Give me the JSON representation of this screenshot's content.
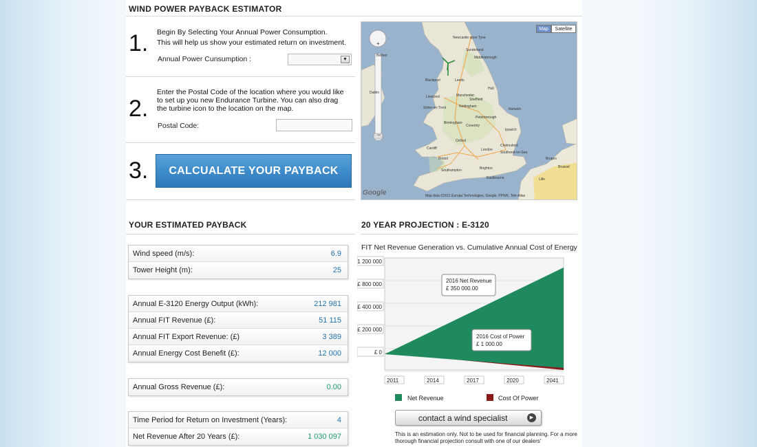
{
  "app": {
    "title": "WIND POWER PAYBACK ESTIMATOR"
  },
  "step1": {
    "number": "1.",
    "line1": "Begin By Selecting Your Annual Power Consumption.",
    "line2": "This will help us show your estimated return on investment.",
    "field_label": "Annual Power Cunsumption :",
    "select_value": ""
  },
  "step2": {
    "number": "2.",
    "line1": "Enter the Postal Code of the location where you would like",
    "line2": "to set up you new Endurance Turbine. You can also drag",
    "line3": "the turbine icon to the location on the map.",
    "field_label": "Postal Code:",
    "input_value": ""
  },
  "step3": {
    "number": "3.",
    "button_label": "CALCUALATE YOUR PAYBACK"
  },
  "map": {
    "map_button": "Map",
    "satellite_button": "Satellite",
    "attribution": "Map data ©2011 Europa Technologies, Google, PPWK, Tele Atlas",
    "google_logo": "Google",
    "cities": [
      "Glasgow",
      "Edinburgh",
      "Newcastle upon Tyne",
      "Sunderland",
      "Middlesbrough",
      "Belfast",
      "Blackpool",
      "Leeds",
      "Hull",
      "Manchester",
      "Liverpool",
      "Sheffield",
      "Stoke-on-Trent",
      "Nottingham",
      "Norwich",
      "Birmingham",
      "Coventry",
      "Peterborough",
      "Ipswich",
      "Oxford",
      "Chelmsford",
      "London",
      "Southend-on-Sea",
      "Cardiff",
      "Bristol",
      "Southampton",
      "Brighton",
      "Eastbourne",
      "Bruges",
      "Brussel",
      "Lille",
      "Dublin",
      "Swansea",
      "Telford",
      "Luton",
      "Reading"
    ]
  },
  "payback": {
    "heading": "YOUR ESTIMATED PAYBACK",
    "group1": [
      {
        "label": "Wind speed (m/s):",
        "value": "6.9"
      },
      {
        "label": "Tower Height (m):",
        "value": "25"
      }
    ],
    "group2": [
      {
        "label": "Annual E-3120 Energy Output (kWh):",
        "value": "212 981"
      },
      {
        "label": "Annual FIT Revenue (£):",
        "value": "51 115"
      },
      {
        "label": "Annual FIT Export Revenue: (£)",
        "value": "3 389"
      },
      {
        "label": "Annual Energy Cost Benefit (£):",
        "value": "12 000"
      }
    ],
    "group3": [
      {
        "label": "Annual Gross Revenue (£):",
        "value": "0.00"
      }
    ],
    "group4": [
      {
        "label": "Time Period for Return on Investment (Years):",
        "value": "4"
      },
      {
        "label": "Net Revenue After 20 Years (£):",
        "value": "1 030 097"
      }
    ]
  },
  "projection": {
    "heading": "20 YEAR PROJECTION : E-3120",
    "subtitle": "FIT Net Revenue Generation vs. Cumulative Annual Cost of Energy",
    "callout_net_title": "2016 Net Revenue",
    "callout_net_value": "£ 350 000.00",
    "callout_cost_title": "2016 Cost of Power",
    "callout_cost_value": "£ 1 000.00",
    "contact_label": "contact a wind specialist",
    "disclaimer": "This is an estimation only.  Not to be used for financial planning.  For a more thorough financial projection consult with one of our dealers'"
  },
  "chart_data": {
    "type": "area",
    "ylim": [
      0,
      1200000
    ],
    "y_ticks": [
      "£ 1 200 000",
      "£ 800 000",
      "£ 400 000",
      "£ 200 000",
      "£ 0"
    ],
    "x_ticks": [
      "2011",
      "2014",
      "2017",
      "2020",
      "2041"
    ],
    "series": [
      {
        "name": "Net Revenue",
        "color": "#1e8a5e",
        "points": [
          [
            2011,
            -60000
          ],
          [
            2041,
            1030097
          ]
        ]
      },
      {
        "name": "Cost Of Power",
        "color": "#8b1b1b",
        "points": [
          [
            2011,
            0
          ],
          [
            2041,
            -40000
          ]
        ]
      }
    ],
    "annotations": [
      {
        "year": 2016,
        "label": "2016 Net Revenue",
        "value": "£ 350 000.00"
      },
      {
        "year": 2016,
        "label": "2016 Cost of Power",
        "value": "£ 1 000.00"
      }
    ],
    "grid": true,
    "legend": "bottom"
  }
}
